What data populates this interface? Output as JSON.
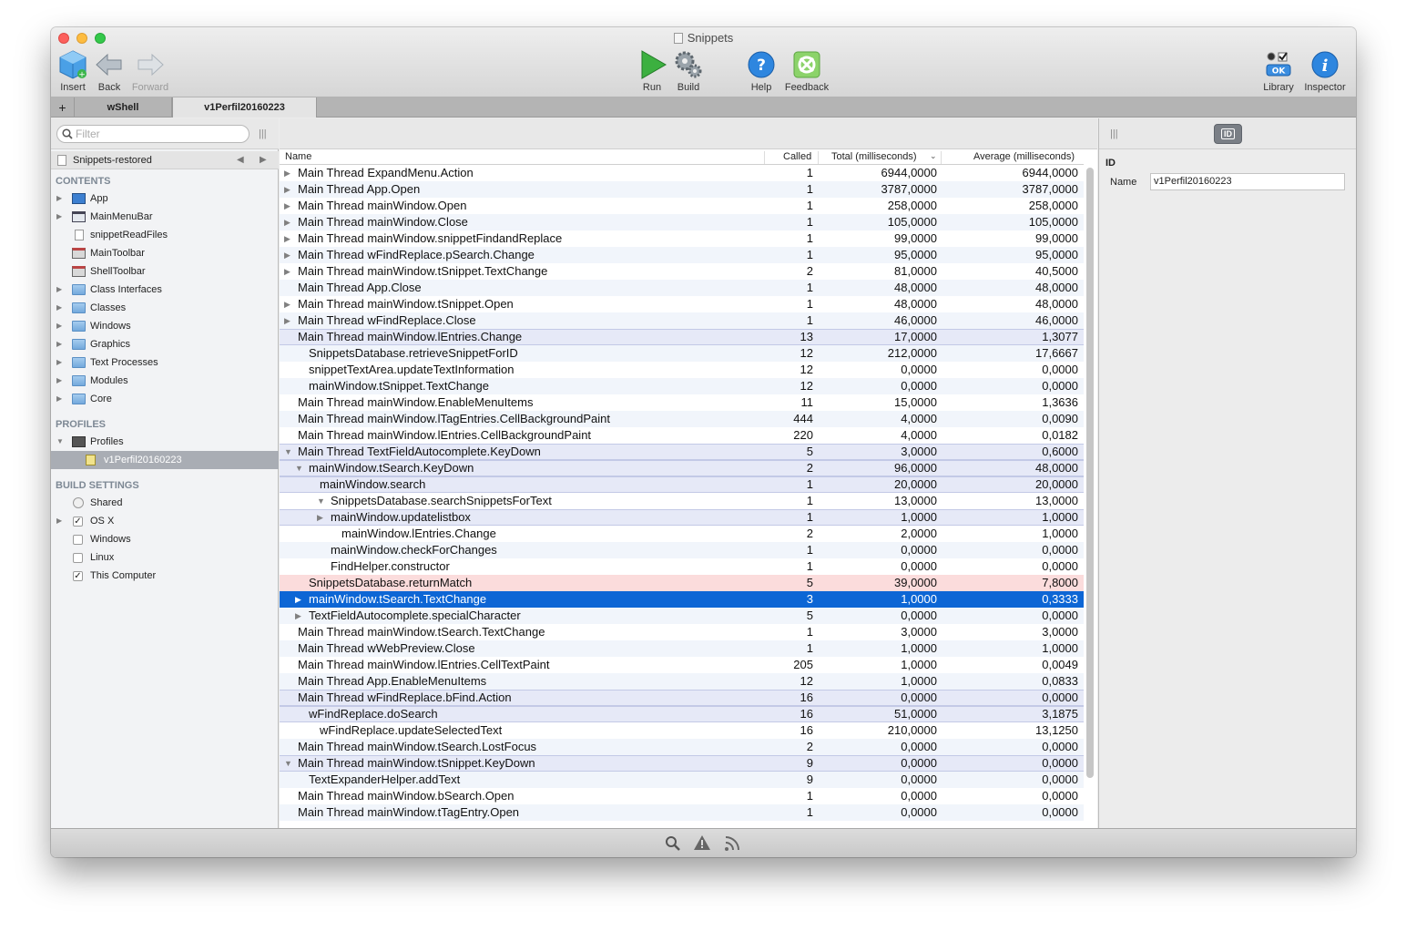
{
  "window": {
    "title": "Snippets"
  },
  "toolbar": {
    "insert": "Insert",
    "back": "Back",
    "forward": "Forward",
    "run": "Run",
    "build": "Build",
    "help": "Help",
    "feedback": "Feedback",
    "library": "Library",
    "inspector": "Inspector"
  },
  "tabs": {
    "add": "+",
    "items": [
      "wShell",
      "v1Perfil20160223"
    ]
  },
  "filter": {
    "placeholder": "Filter"
  },
  "project": {
    "name": "Snippets-restored"
  },
  "sidebar": {
    "contents_header": "CONTENTS",
    "contents": [
      "App",
      "MainMenuBar",
      "snippetReadFiles",
      "MainToolbar",
      "ShellToolbar",
      "Class Interfaces",
      "Classes",
      "Windows",
      "Graphics",
      "Text Processes",
      "Modules",
      "Core"
    ],
    "profiles_header": "PROFILES",
    "profiles_label": "Profiles",
    "profile_item": "v1Perfil20160223",
    "build_header": "BUILD SETTINGS",
    "build": [
      "Shared",
      "OS X",
      "Windows",
      "Linux",
      "This Computer"
    ]
  },
  "table": {
    "headers": {
      "name": "Name",
      "called": "Called",
      "total": "Total (milliseconds)",
      "average": "Average (milliseconds)"
    },
    "rows": [
      {
        "name": "Main Thread ExpandMenu.Action",
        "called": "1",
        "total": "6944,0000",
        "avg": "6944,0000"
      },
      {
        "name": "Main Thread App.Open",
        "called": "1",
        "total": "3787,0000",
        "avg": "3787,0000"
      },
      {
        "name": "Main Thread mainWindow.Open",
        "called": "1",
        "total": "258,0000",
        "avg": "258,0000"
      },
      {
        "name": "Main Thread mainWindow.Close",
        "called": "1",
        "total": "105,0000",
        "avg": "105,0000"
      },
      {
        "name": "Main Thread mainWindow.snippetFindandReplace",
        "called": "1",
        "total": "99,0000",
        "avg": "99,0000"
      },
      {
        "name": "Main Thread wFindReplace.pSearch.Change",
        "called": "1",
        "total": "95,0000",
        "avg": "95,0000"
      },
      {
        "name": "Main Thread mainWindow.tSnippet.TextChange",
        "called": "2",
        "total": "81,0000",
        "avg": "40,5000"
      },
      {
        "name": "Main Thread App.Close",
        "called": "1",
        "total": "48,0000",
        "avg": "48,0000"
      },
      {
        "name": "Main Thread mainWindow.tSnippet.Open",
        "called": "1",
        "total": "48,0000",
        "avg": "48,0000"
      },
      {
        "name": "Main Thread wFindReplace.Close",
        "called": "1",
        "total": "46,0000",
        "avg": "46,0000"
      },
      {
        "name": "Main Thread mainWindow.lEntries.Change",
        "called": "13",
        "total": "17,0000",
        "avg": "1,3077"
      },
      {
        "name": "SnippetsDatabase.retrieveSnippetForID",
        "called": "12",
        "total": "212,0000",
        "avg": "17,6667"
      },
      {
        "name": "snippetTextArea.updateTextInformation",
        "called": "12",
        "total": "0,0000",
        "avg": "0,0000"
      },
      {
        "name": "mainWindow.tSnippet.TextChange",
        "called": "12",
        "total": "0,0000",
        "avg": "0,0000"
      },
      {
        "name": "Main Thread mainWindow.EnableMenuItems",
        "called": "11",
        "total": "15,0000",
        "avg": "1,3636"
      },
      {
        "name": "Main Thread mainWindow.lTagEntries.CellBackgroundPaint",
        "called": "444",
        "total": "4,0000",
        "avg": "0,0090"
      },
      {
        "name": "Main Thread mainWindow.lEntries.CellBackgroundPaint",
        "called": "220",
        "total": "4,0000",
        "avg": "0,0182"
      },
      {
        "name": "Main Thread TextFieldAutocomplete.KeyDown",
        "called": "5",
        "total": "3,0000",
        "avg": "0,6000"
      },
      {
        "name": "mainWindow.tSearch.KeyDown",
        "called": "2",
        "total": "96,0000",
        "avg": "48,0000"
      },
      {
        "name": "mainWindow.search",
        "called": "1",
        "total": "20,0000",
        "avg": "20,0000"
      },
      {
        "name": "SnippetsDatabase.searchSnippetsForText",
        "called": "1",
        "total": "13,0000",
        "avg": "13,0000"
      },
      {
        "name": "mainWindow.updatelistbox",
        "called": "1",
        "total": "1,0000",
        "avg": "1,0000"
      },
      {
        "name": "mainWindow.lEntries.Change",
        "called": "2",
        "total": "2,0000",
        "avg": "1,0000"
      },
      {
        "name": "mainWindow.checkForChanges",
        "called": "1",
        "total": "0,0000",
        "avg": "0,0000"
      },
      {
        "name": "FindHelper.constructor",
        "called": "1",
        "total": "0,0000",
        "avg": "0,0000"
      },
      {
        "name": "SnippetsDatabase.returnMatch",
        "called": "5",
        "total": "39,0000",
        "avg": "7,8000"
      },
      {
        "name": "mainWindow.tSearch.TextChange",
        "called": "3",
        "total": "1,0000",
        "avg": "0,3333"
      },
      {
        "name": "TextFieldAutocomplete.specialCharacter",
        "called": "5",
        "total": "0,0000",
        "avg": "0,0000"
      },
      {
        "name": "Main Thread mainWindow.tSearch.TextChange",
        "called": "1",
        "total": "3,0000",
        "avg": "3,0000"
      },
      {
        "name": "Main Thread wWebPreview.Close",
        "called": "1",
        "total": "1,0000",
        "avg": "1,0000"
      },
      {
        "name": "Main Thread mainWindow.lEntries.CellTextPaint",
        "called": "205",
        "total": "1,0000",
        "avg": "0,0049"
      },
      {
        "name": "Main Thread App.EnableMenuItems",
        "called": "12",
        "total": "1,0000",
        "avg": "0,0833"
      },
      {
        "name": "Main Thread wFindReplace.bFind.Action",
        "called": "16",
        "total": "0,0000",
        "avg": "0,0000"
      },
      {
        "name": "wFindReplace.doSearch",
        "called": "16",
        "total": "51,0000",
        "avg": "3,1875"
      },
      {
        "name": "wFindReplace.updateSelectedText",
        "called": "16",
        "total": "210,0000",
        "avg": "13,1250"
      },
      {
        "name": "Main Thread mainWindow.tSearch.LostFocus",
        "called": "2",
        "total": "0,0000",
        "avg": "0,0000"
      },
      {
        "name": "Main Thread mainWindow.tSnippet.KeyDown",
        "called": "9",
        "total": "0,0000",
        "avg": "0,0000"
      },
      {
        "name": "TextExpanderHelper.addText",
        "called": "9",
        "total": "0,0000",
        "avg": "0,0000"
      },
      {
        "name": "Main Thread mainWindow.bSearch.Open",
        "called": "1",
        "total": "0,0000",
        "avg": "0,0000"
      },
      {
        "name": "Main Thread mainWindow.tTagEntry.Open",
        "called": "1",
        "total": "0,0000",
        "avg": "0,0000"
      }
    ]
  },
  "inspector": {
    "tab": "ID",
    "section": "ID",
    "name_label": "Name",
    "name_value": "v1Perfil20160223"
  },
  "colors": {
    "selection": "#0d66d5",
    "hot": "#fbdcdc",
    "expanded": "#e6e9f7"
  }
}
